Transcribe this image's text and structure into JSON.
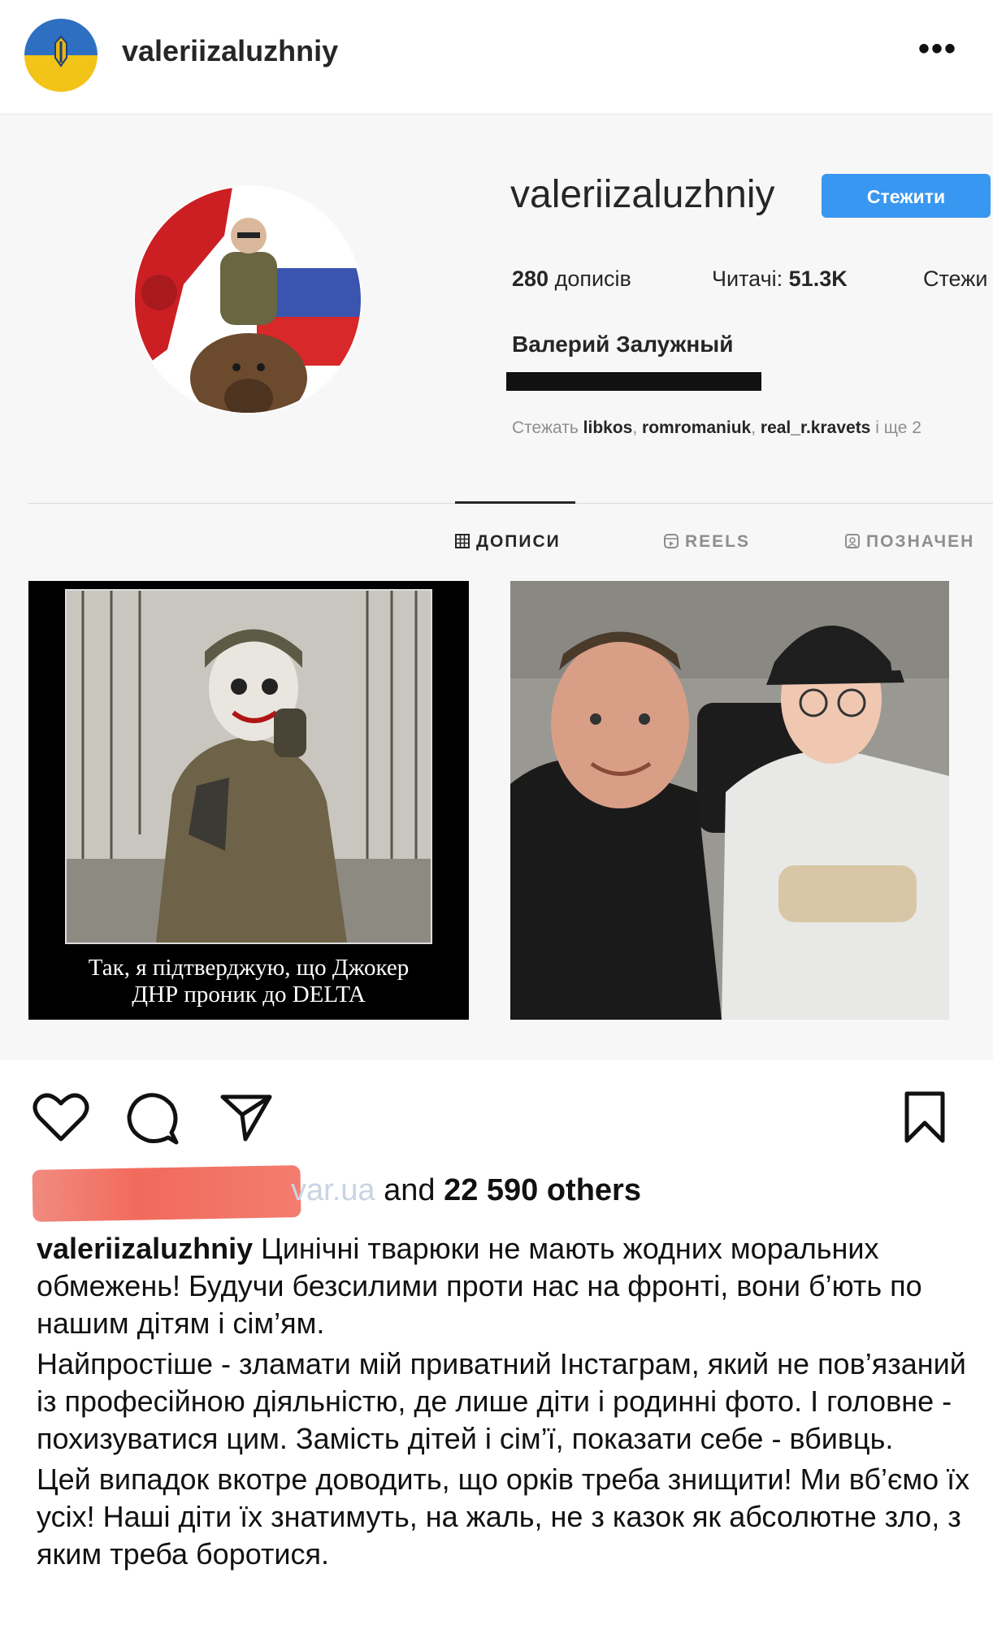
{
  "header": {
    "username": "valeriizaluzhniy",
    "more_icon": "more-horizontal-icon",
    "more_label": "•••"
  },
  "profile": {
    "username": "valeriizaluzhniy",
    "follow_label": "Стежити",
    "posts_count": "280",
    "posts_label": "дописів",
    "followers_label": "Читачі:",
    "followers_count": "51.3K",
    "following_label": "Стежи",
    "full_name": "Валерий Залужный",
    "followed_by_prefix": "Стежать",
    "followed_by_users": [
      "libkos",
      "romromaniuk",
      "real_r.kravets"
    ],
    "followed_by_suffix": "і ще 2",
    "accent_color": "#3897f0"
  },
  "tabs": [
    {
      "label": "ДОПИСИ",
      "icon": "grid-icon",
      "active": true
    },
    {
      "label": "REELS",
      "icon": "reels-icon",
      "active": false
    },
    {
      "label": "ПОЗНАЧЕН",
      "icon": "tagged-icon",
      "active": false
    }
  ],
  "posts": [
    {
      "caption_line1": "Так, я підтверджую, що Джокер",
      "caption_line2": "ДНР проник до DELTA"
    },
    {
      "caption_line1": "",
      "caption_line2": ""
    }
  ],
  "actions": {
    "like_icon": "heart-icon",
    "comment_icon": "comment-icon",
    "share_icon": "send-icon",
    "save_icon": "bookmark-icon"
  },
  "likes": {
    "faded_name": "var.ua",
    "and_text": " and ",
    "count_text": "22 590 others"
  },
  "caption": {
    "username": "valeriizaluzhniy",
    "paragraph1": " Цинічні тварюки не мають жодних моральних обмежень! Будучи безсилими проти нас на фронті, вони б’ють по нашим дітям і сім’ям.",
    "paragraph2": "Найпростіше - зламати мій приватний Інстаграм, який не пов’язаний із професійною діяльністю, де лише діти і родинні фото. І головне - похизуватися цим. Замість дітей і сім’ї, показати себе - вбивць.",
    "paragraph3": "Цей випадок вкотре доводить, що орків треба знищити! Ми вб’ємо їх усіх! Наші діти їх знатимуть, на жаль, не з казок як абсолютне зло, з яким треба боротися."
  }
}
